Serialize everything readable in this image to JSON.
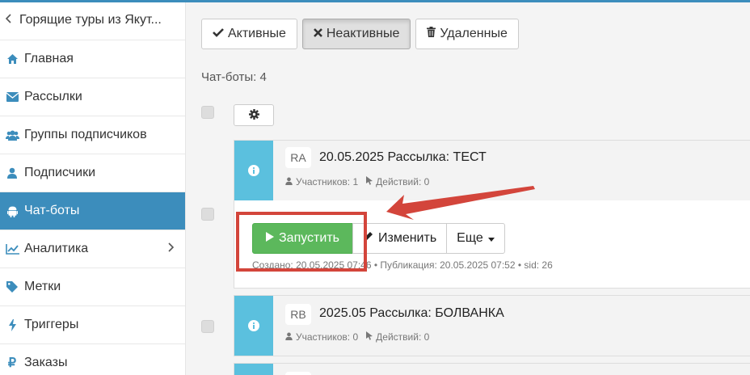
{
  "sidebar": {
    "header": "Горящие туры из Якут...",
    "items": [
      {
        "label": "Главная",
        "icon": "home-icon"
      },
      {
        "label": "Рассылки",
        "icon": "envelope-icon"
      },
      {
        "label": "Группы подписчиков",
        "icon": "users-icon"
      },
      {
        "label": "Подписчики",
        "icon": "user-icon"
      },
      {
        "label": "Чат-боты",
        "icon": "android-icon",
        "active": true
      },
      {
        "label": "Аналитика",
        "icon": "line-chart-icon"
      },
      {
        "label": "Метки",
        "icon": "tag-icon"
      },
      {
        "label": "Триггеры",
        "icon": "bolt-icon"
      },
      {
        "label": "Заказы",
        "icon": "ruble-icon",
        "glyph": "₽"
      }
    ]
  },
  "filters": {
    "active": "Активные",
    "inactive": "Неактивные",
    "deleted": "Удаленные"
  },
  "count_text": "Чат-боты: 4",
  "bots": [
    {
      "badge": "RA",
      "title": "20.05.2025 Рассылка: ТЕСТ",
      "participants": "Участников: 1",
      "actions": "Действий: 0",
      "created": "Создано: 20.05.2025 07:46 • Публикация: 20.05.2025 07:52 • sid: 26"
    },
    {
      "badge": "RB",
      "title": "2025.05 Рассылка: БОЛВАНКА",
      "participants": "Участников: 0",
      "actions": "Действий: 0"
    }
  ],
  "buttons": {
    "run": "Запустить",
    "edit": "Изменить",
    "more": "Еще"
  },
  "colors": {
    "accent": "#3c8dbc",
    "info": "#5bc0de",
    "success": "#5cb85c",
    "annotation": "#d3453b"
  }
}
